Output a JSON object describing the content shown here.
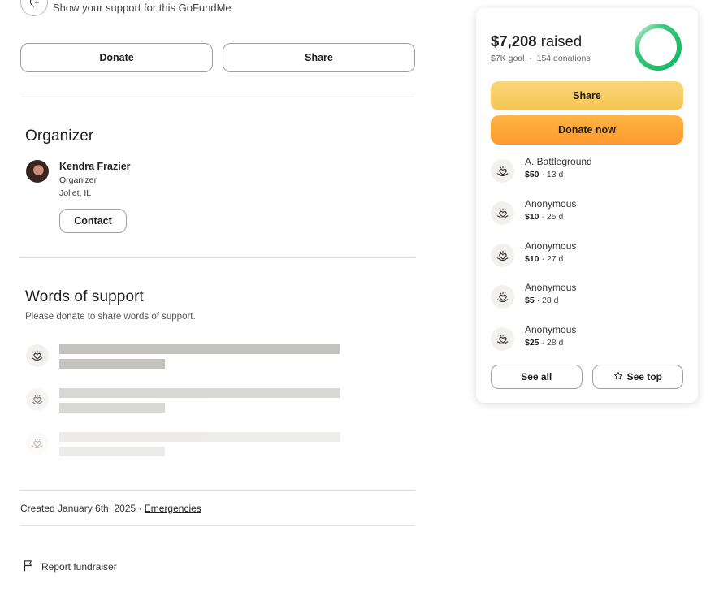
{
  "support_line": "Show your support for this GoFundMe",
  "actions": {
    "donate_label": "Donate",
    "share_label": "Share"
  },
  "organizer_section": {
    "title": "Organizer",
    "name": "Kendra Frazier",
    "role": "Organizer",
    "location": "Joliet, IL",
    "contact_label": "Contact"
  },
  "words_section": {
    "title": "Words of support",
    "subtitle": "Please donate to share words of support."
  },
  "footer": {
    "created": "Created January 6th, 2025 · ",
    "category": "Emergencies",
    "report_label": "Report fundraiser"
  },
  "card": {
    "raised_amount": "$7,208",
    "raised_word": " raised",
    "goal": "$7K goal",
    "donations": "154 donations",
    "progress": 1.0,
    "share_label": "Share",
    "donate_label": "Donate now",
    "see_all_label": "See all",
    "see_top_label": "See top",
    "donors": [
      {
        "name": "A. Battleground",
        "amount": "$50",
        "age": " · 13 d"
      },
      {
        "name": "Anonymous",
        "amount": "$10",
        "age": " · 25 d"
      },
      {
        "name": "Anonymous",
        "amount": "$10",
        "age": " · 27 d"
      },
      {
        "name": "Anonymous",
        "amount": "$5",
        "age": " · 28 d"
      },
      {
        "name": "Anonymous",
        "amount": "$25",
        "age": " · 28 d"
      }
    ]
  },
  "colors": {
    "ring_start": "#0fb765",
    "ring_end": "#c8efd3",
    "share_yellow": "#f8cd62",
    "donate_orange": "#fea43a"
  },
  "icons": {
    "support": "heart-plus-icon",
    "donor": "heart-hand-icon",
    "star": "star-icon",
    "flag": "flag-icon"
  }
}
